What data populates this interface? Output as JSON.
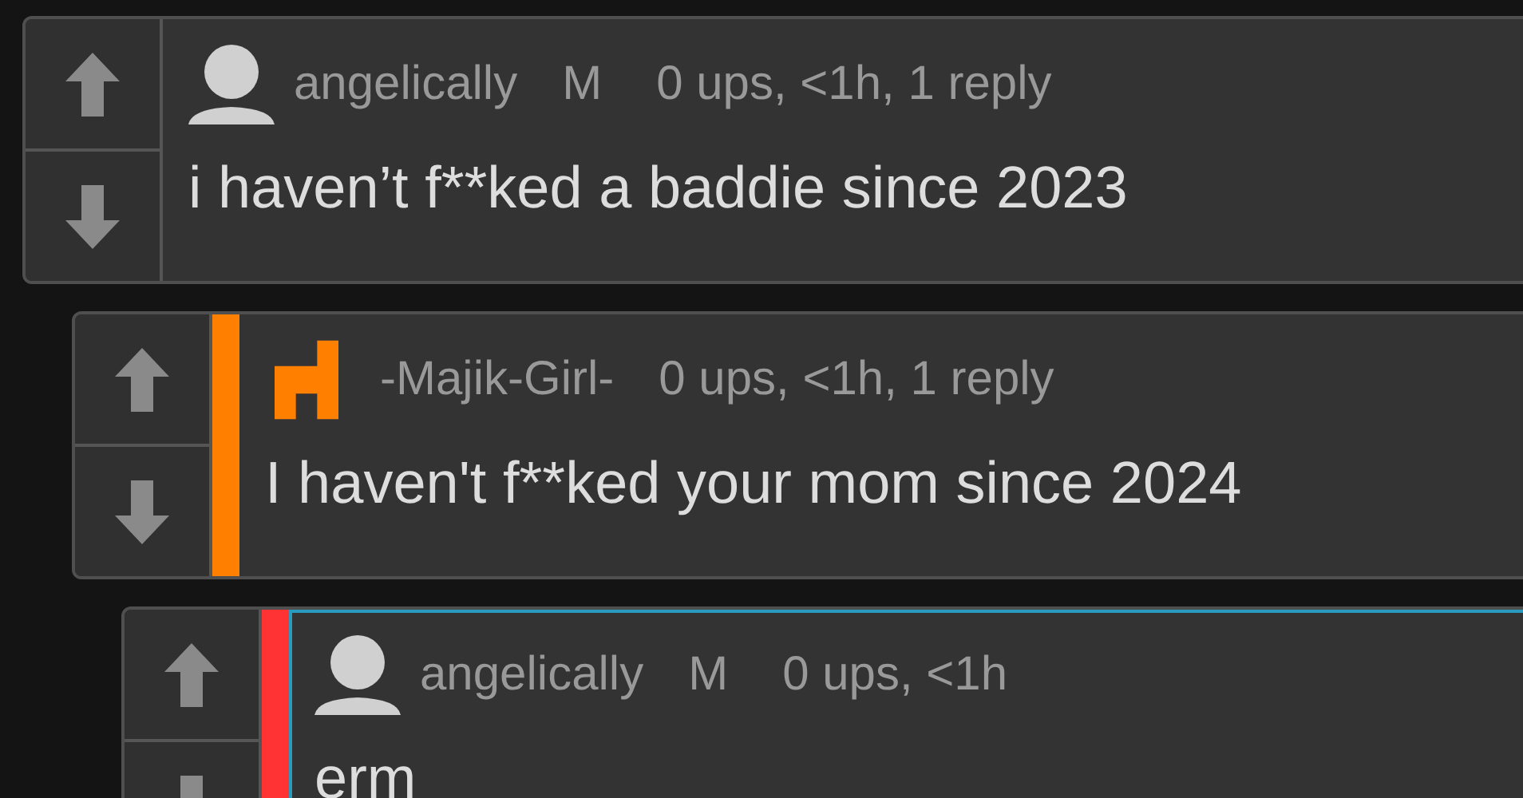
{
  "comments": [
    {
      "kind": "silhouette",
      "username": "angelically",
      "badge": "M",
      "meta": "0 ups, <1h, 1 reply",
      "text": "i haven’t f**ked a baddie since 2023",
      "highlighted": false,
      "replies": [
        {
          "kind": "pixel",
          "username": "-Majik-Girl-",
          "meta": "0 ups, <1h, 1 reply",
          "text": "I haven't f**ked your mom since 2024",
          "color": "#ff8000",
          "highlighted": false,
          "replies": [
            {
              "kind": "silhouette",
              "username": "angelically",
              "badge": "M",
              "meta": "0 ups, <1h",
              "text": "erm",
              "color": "#ff3333",
              "highlighted": true
            }
          ]
        }
      ]
    }
  ]
}
